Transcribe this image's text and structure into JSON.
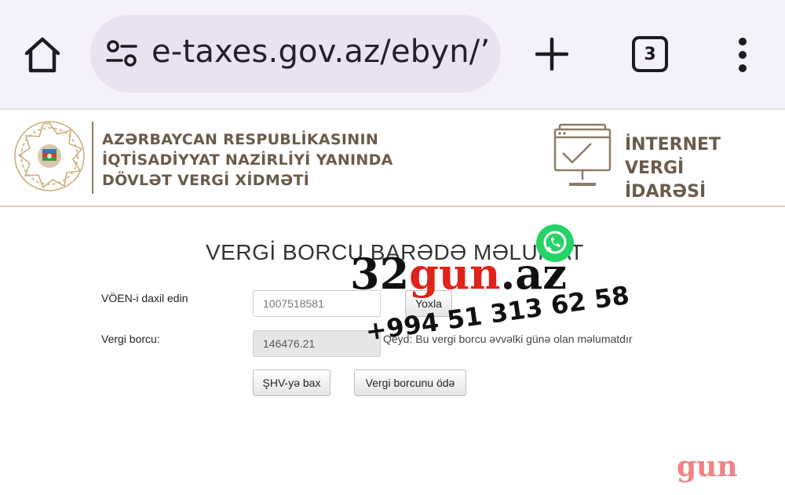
{
  "browser": {
    "url": "e-taxes.gov.az/ebyn/’",
    "tab_count": "3",
    "icons": [
      "home-icon",
      "tune-icon",
      "plus-icon",
      "tab-switcher-icon",
      "more-vert-icon"
    ]
  },
  "header": {
    "org_line1": "AZƏRBAYCAN RESPUBLİKASININ",
    "org_line2": "İQTİSADİYYAT NAZİRLİYİ YANINDA",
    "org_line3": "DÖVLƏT VERGİ XİDMƏTİ",
    "portal_line1": "İNTERNET VERGİ",
    "portal_line2": "İDARƏSİ",
    "brand_color": "#6b5b4a"
  },
  "form": {
    "title": "VERGİ BORCU BARƏDƏ MƏLUMAT",
    "voen_label": "VÖEN-i daxil edin",
    "voen_value": "1007518581",
    "check_button": "Yoxla",
    "debt_label": "Vergi borcu:",
    "debt_value": "146476.21",
    "debt_note": "Qeyd: Bu vergi borcu əvvəlki günə olan məlumatdır",
    "shv_button": "ŞHV-yə bax",
    "pay_button": "Vergi borcunu ödə"
  },
  "watermark": {
    "site_prefix": "32",
    "site_red": "gun",
    "site_suffix": ".az",
    "phone": "+994 51 313 62 58",
    "corner": "gun",
    "colors": {
      "red": "#e0221a",
      "whatsapp": "#25d366"
    }
  }
}
